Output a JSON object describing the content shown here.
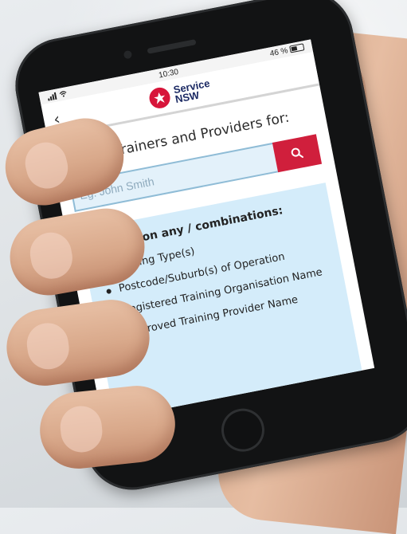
{
  "status_bar": {
    "time": "10:30",
    "battery": "46 %"
  },
  "header": {
    "logo_line1": "Service",
    "logo_line2": "NSW"
  },
  "search": {
    "heading": "Search Trainers and Providers for:",
    "placeholder": "Eg: John Smith"
  },
  "info": {
    "title": "Search on any / combinations:",
    "items": [
      "Training Type(s)",
      "Postcode/Suburb(s) of Operation",
      "Registered Training Organisation Name",
      "Approved Training Provider Name"
    ]
  },
  "colors": {
    "brand_red": "#d01f3c",
    "brand_navy": "#1c2a64",
    "panel_blue": "#d4ecfa"
  },
  "icons": {
    "back": "chevron-left-icon",
    "search": "search-icon"
  }
}
